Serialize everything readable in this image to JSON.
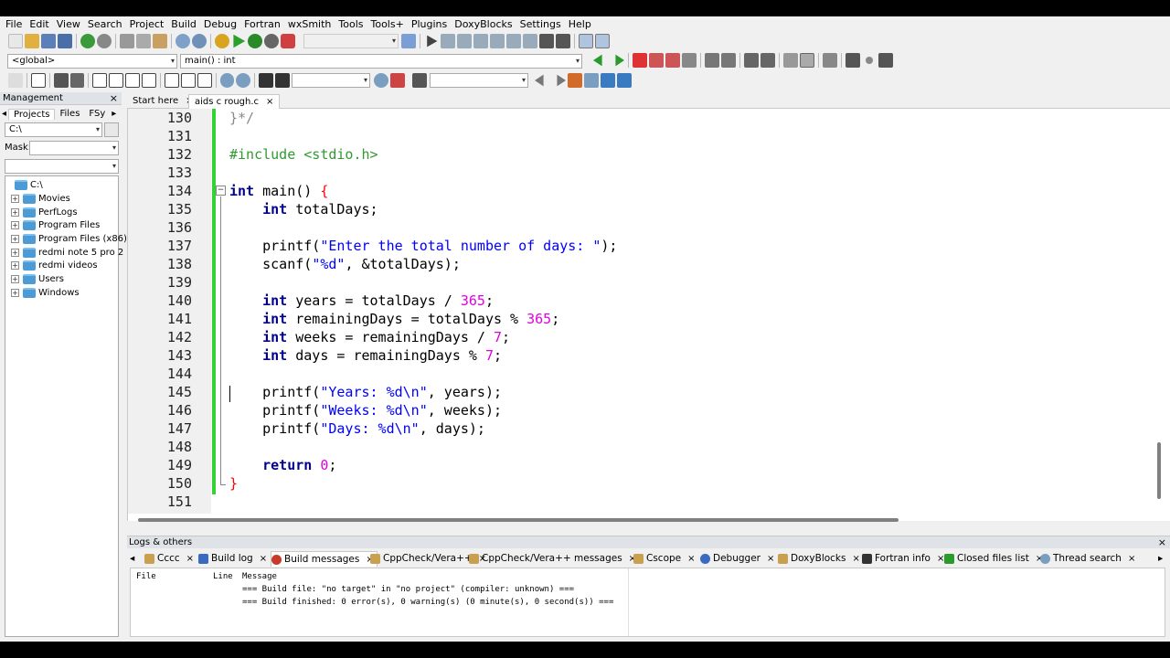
{
  "menu": [
    "File",
    "Edit",
    "View",
    "Search",
    "Project",
    "Build",
    "Debug",
    "Fortran",
    "wxSmith",
    "Tools",
    "Tools+",
    "Plugins",
    "DoxyBlocks",
    "Settings",
    "Help"
  ],
  "toolbar": {
    "scope": "<global>",
    "function": "main() : int"
  },
  "management": {
    "title": "Management",
    "tabs": [
      "Projects",
      "Files",
      "FSy"
    ],
    "path": "C:\\",
    "mask_label": "Mask:",
    "tree": [
      "C:\\",
      "Movies",
      "PerfLogs",
      "Program Files",
      "Program Files (x86)",
      "redmi note 5 pro 2",
      "redmi videos",
      "Users",
      "Windows"
    ]
  },
  "editor": {
    "tabs": [
      "Start here",
      "aids c rough.c"
    ],
    "lines": [
      {
        "n": "130",
        "t": "}*/"
      },
      {
        "n": "131",
        "t": ""
      },
      {
        "n": "132",
        "t": "#include <stdio.h>"
      },
      {
        "n": "133",
        "t": ""
      },
      {
        "n": "134",
        "t": "int main() {"
      },
      {
        "n": "135",
        "t": "    int totalDays;"
      },
      {
        "n": "136",
        "t": ""
      },
      {
        "n": "137",
        "t": "    printf(\"Enter the total number of days: \");"
      },
      {
        "n": "138",
        "t": "    scanf(\"%d\", &totalDays);"
      },
      {
        "n": "139",
        "t": ""
      },
      {
        "n": "140",
        "t": "    int years = totalDays / 365;"
      },
      {
        "n": "141",
        "t": "    int remainingDays = totalDays % 365;"
      },
      {
        "n": "142",
        "t": "    int weeks = remainingDays / 7;"
      },
      {
        "n": "143",
        "t": "    int days = remainingDays % 7;"
      },
      {
        "n": "144",
        "t": ""
      },
      {
        "n": "145",
        "t": "    printf(\"Years: %d\\n\", years);"
      },
      {
        "n": "146",
        "t": "    printf(\"Weeks: %d\\n\", weeks);"
      },
      {
        "n": "147",
        "t": "    printf(\"Days: %d\\n\", days);"
      },
      {
        "n": "148",
        "t": ""
      },
      {
        "n": "149",
        "t": "    return 0;"
      },
      {
        "n": "150",
        "t": "}"
      },
      {
        "n": "151",
        "t": ""
      }
    ]
  },
  "logs": {
    "title": "Logs & others",
    "tabs": [
      "Cccc",
      "Build log",
      "Build messages",
      "CppCheck/Vera++",
      "CppCheck/Vera++ messages",
      "Cscope",
      "Debugger",
      "DoxyBlocks",
      "Fortran info",
      "Closed files list",
      "Thread search"
    ],
    "columns": [
      "File",
      "Line",
      "Message"
    ],
    "messages": [
      "=== Build file: \"no target\" in \"no project\" (compiler: unknown) ===",
      "=== Build finished: 0 error(s), 0 warning(s) (0 minute(s), 0 second(s)) ==="
    ]
  },
  "colors": {
    "accent_green": "#33d333",
    "keyword": "#00008b",
    "preprocessor": "#2f9a2f",
    "string": "#0000ff",
    "number": "#e000e0"
  }
}
